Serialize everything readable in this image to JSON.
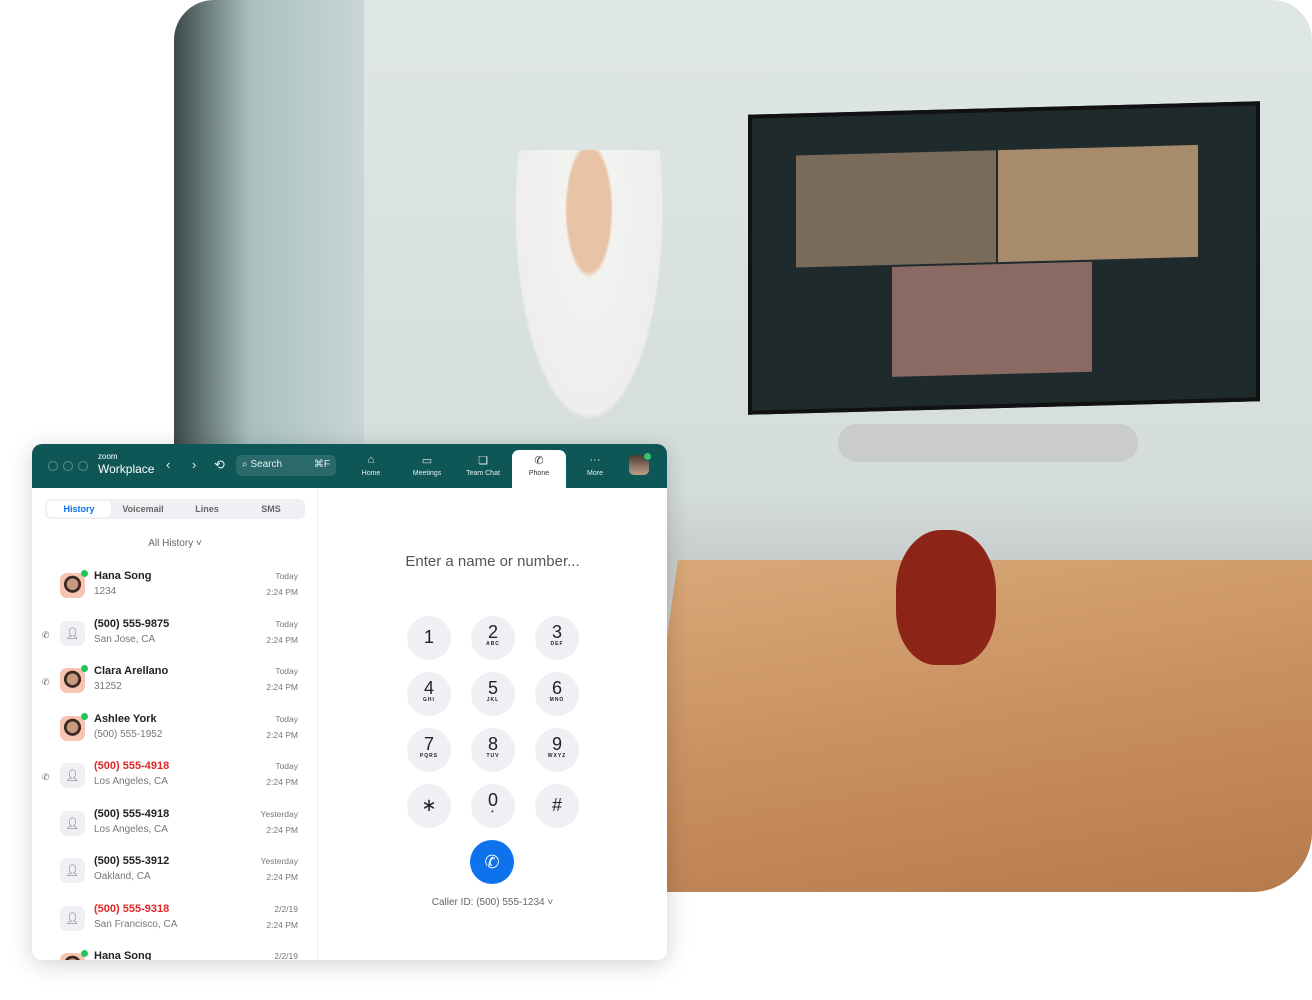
{
  "colors": {
    "header": "#0f5656",
    "accent": "#0e72ed",
    "missed": "#e02828",
    "online": "#23c45c"
  },
  "app": {
    "brand_small": "zoom",
    "brand": "Workplace",
    "search_label": "Search",
    "search_shortcut": "⌘F"
  },
  "tabs": [
    {
      "label": "Home",
      "icon": "home-icon"
    },
    {
      "label": "Meetings",
      "icon": "calendar-icon"
    },
    {
      "label": "Team Chat",
      "icon": "chat-icon"
    },
    {
      "label": "Phone",
      "icon": "phone-icon",
      "active": true
    },
    {
      "label": "More",
      "icon": "more-icon"
    }
  ],
  "phone": {
    "subtabs": [
      "History",
      "Voicemail",
      "Lines",
      "SMS"
    ],
    "filter": "All History ˅",
    "history": [
      {
        "name": "Hana Song",
        "sub": "1234",
        "date": "Today",
        "time": "2:24 PM",
        "photo": true,
        "missed": false,
        "call_icon": false
      },
      {
        "name": "(500) 555-9875",
        "sub": "San Jose, CA",
        "date": "Today",
        "time": "2:24 PM",
        "photo": false,
        "missed": false,
        "call_icon": true
      },
      {
        "name": "Clara Arellano",
        "sub": "31252",
        "date": "Today",
        "time": "2:24 PM",
        "photo": true,
        "missed": false,
        "call_icon": true
      },
      {
        "name": "Ashlee York",
        "sub": "(500) 555-1952",
        "date": "Today",
        "time": "2:24 PM",
        "photo": true,
        "missed": false,
        "call_icon": false
      },
      {
        "name": "(500) 555-4918",
        "sub": "Los Angeles, CA",
        "date": "Today",
        "time": "2:24 PM",
        "photo": false,
        "missed": true,
        "call_icon": true
      },
      {
        "name": "(500) 555-4918",
        "sub": "Los Angeles, CA",
        "date": "Yesterday",
        "time": "2:24 PM",
        "photo": false,
        "missed": false,
        "call_icon": false
      },
      {
        "name": "(500) 555-3912",
        "sub": "Oakland, CA",
        "date": "Yesterday",
        "time": "2:24 PM",
        "photo": false,
        "missed": false,
        "call_icon": false
      },
      {
        "name": "(500) 555-9318",
        "sub": "San Francisco, CA",
        "date": "2/2/19",
        "time": "2:24 PM",
        "photo": false,
        "missed": true,
        "call_icon": false
      },
      {
        "name": "Hana Song",
        "sub": "",
        "date": "2/2/19",
        "time": "",
        "photo": true,
        "missed": false,
        "call_icon": true
      }
    ],
    "entry_placeholder": "Enter a name or number...",
    "keys": [
      {
        "n": "1",
        "l": ""
      },
      {
        "n": "2",
        "l": "ABC"
      },
      {
        "n": "3",
        "l": "DEF"
      },
      {
        "n": "4",
        "l": "GHI"
      },
      {
        "n": "5",
        "l": "JKL"
      },
      {
        "n": "6",
        "l": "MNO"
      },
      {
        "n": "7",
        "l": "PQRS"
      },
      {
        "n": "8",
        "l": "TUV"
      },
      {
        "n": "9",
        "l": "WXYZ"
      },
      {
        "n": "∗",
        "l": ""
      },
      {
        "n": "0",
        "l": "+"
      },
      {
        "n": "#",
        "l": ""
      }
    ],
    "caller_id": "Caller ID: (500) 555-1234 ˅"
  }
}
